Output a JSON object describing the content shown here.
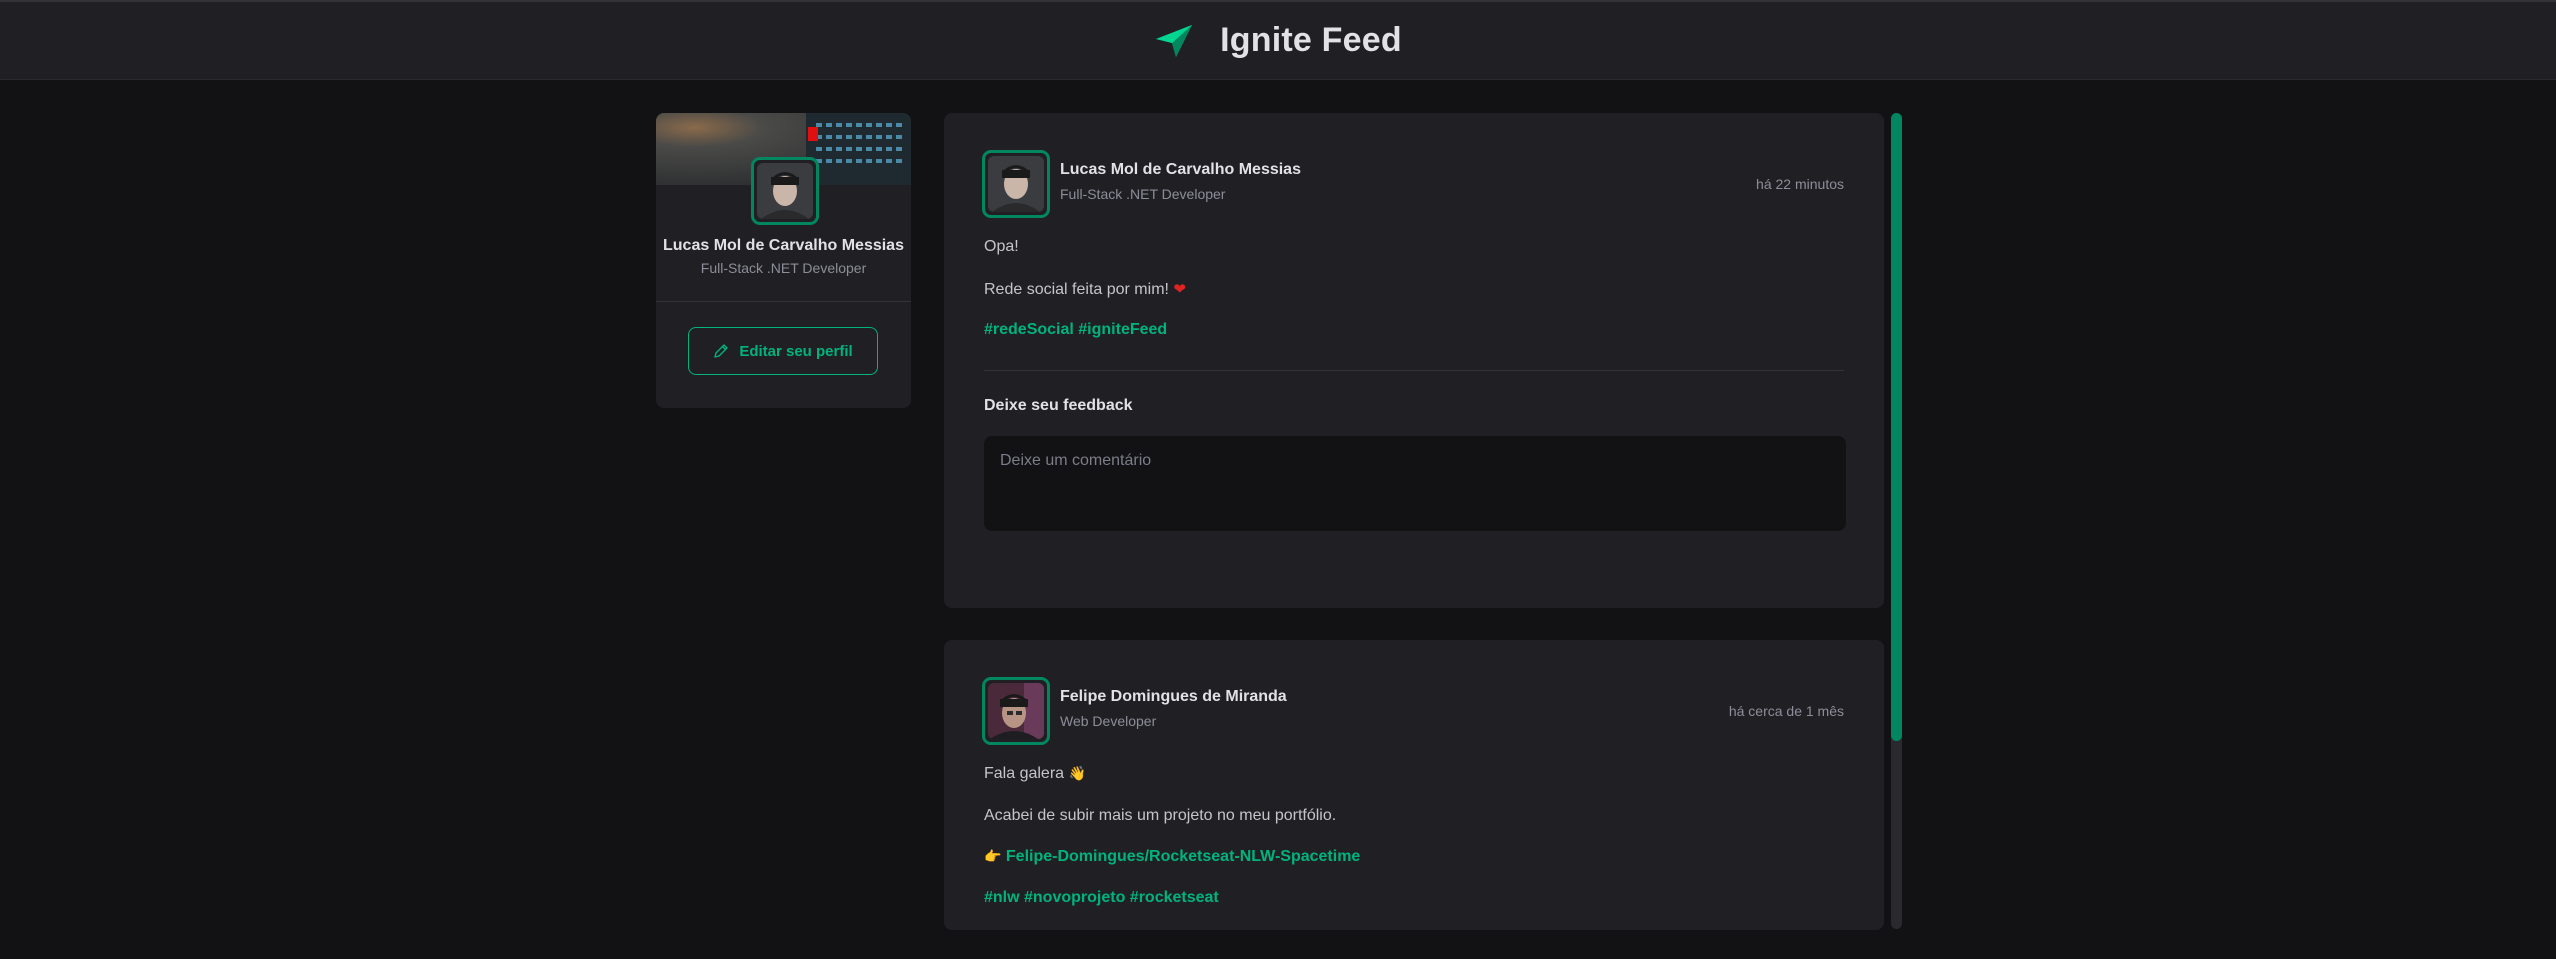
{
  "header": {
    "title": "Ignite Feed",
    "logo_icon": "paper-plane-icon"
  },
  "colors": {
    "accent": "#00b37e",
    "accent_dark": "#00875f",
    "bg": "#121214",
    "card": "#202024"
  },
  "profile": {
    "name": "Lucas Mol de Carvalho Messias",
    "role": "Full-Stack .NET Developer",
    "edit_label": "Editar seu perfil",
    "edit_icon": "pencil-icon"
  },
  "posts": [
    {
      "author": "Lucas Mol de Carvalho Messias",
      "role": "Full-Stack .NET Developer",
      "time": "há 22 minutos",
      "lines": [
        "Opa!",
        "Rede social feita por mim!"
      ],
      "line2_emoji": "❤",
      "hashtags": "#redeSocial #igniteFeed",
      "feedback_title": "Deixe seu feedback",
      "comment_placeholder": "Deixe um comentário"
    },
    {
      "author": "Felipe Domingues de Miranda",
      "role": "Web Developer",
      "time": "há cerca de 1 mês",
      "line1": "Fala galera",
      "line1_emoji": "👋",
      "line2": "Acabei de subir mais um projeto no meu portfólio.",
      "link_emoji": "👉",
      "link": "Felipe-Domingues/Rocketseat-NLW-Spacetime",
      "hashtags": "#nlw #novoprojeto #rocketseat"
    }
  ],
  "scroll": {
    "position_fraction": 0.0,
    "visible_fraction": 0.77
  }
}
